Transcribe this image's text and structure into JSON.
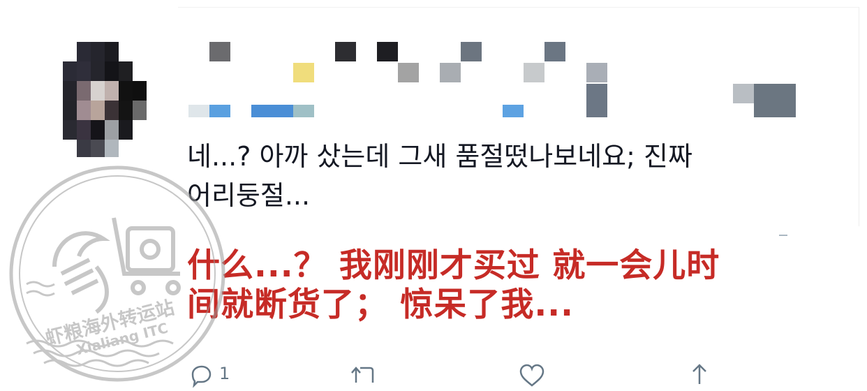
{
  "tweet": {
    "text_korean_line1": "네...? 아까 샀는데 그새 품절떴나보네요; 진짜",
    "text_korean_line2": "어리둥절...",
    "translation_line1": "什么...？ 我刚刚才买过 就一会儿时",
    "translation_line2": "间就断货了； 惊呆了我..."
  },
  "actions": {
    "reply_count": "1",
    "reply_icon": "reply-icon",
    "retweet_icon": "retweet-icon",
    "like_icon": "heart-icon",
    "share_icon": "share-icon"
  },
  "watermark": {
    "chinese": "虾粮海外转运站",
    "english": "Xialiang ITC"
  },
  "colors": {
    "translation": "#c62b26",
    "text": "#141823",
    "icon": "#657786",
    "watermark": "#9a9a9a"
  }
}
